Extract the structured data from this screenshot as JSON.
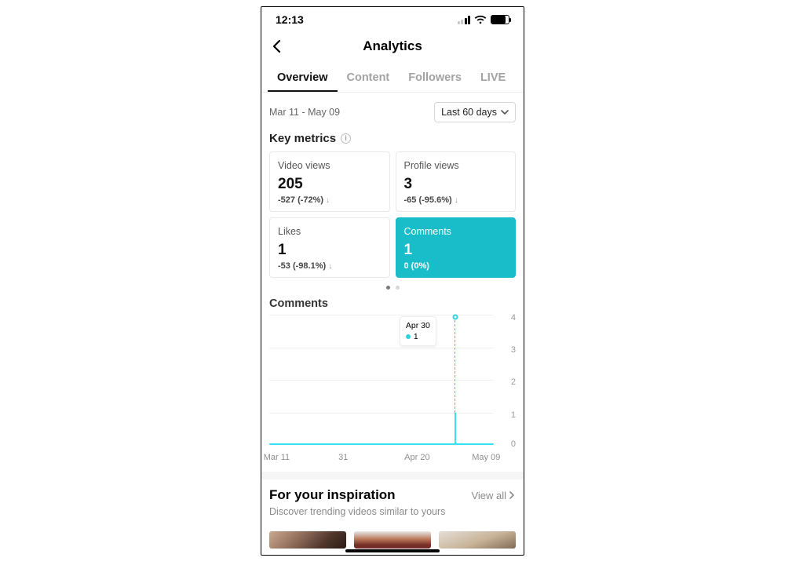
{
  "status": {
    "time": "12:13"
  },
  "nav": {
    "title": "Analytics"
  },
  "tabs": [
    {
      "label": "Overview",
      "active": true
    },
    {
      "label": "Content",
      "active": false
    },
    {
      "label": "Followers",
      "active": false
    },
    {
      "label": "LIVE",
      "active": false
    }
  ],
  "range": {
    "date_span": "Mar 11 - May 09",
    "button_label": "Last 60 days"
  },
  "key_metrics": {
    "heading": "Key metrics",
    "cards": [
      {
        "label": "Video views",
        "value": "205",
        "delta": "-527 (-72%)",
        "selected": false
      },
      {
        "label": "Profile views",
        "value": "3",
        "delta": "-65 (-95.6%)",
        "selected": false
      },
      {
        "label": "Likes",
        "value": "1",
        "delta": "-53 (-98.1%)",
        "selected": false
      },
      {
        "label": "Comments",
        "value": "1",
        "delta": "0 (0%)",
        "selected": true
      }
    ],
    "pager": {
      "total": 2,
      "active": 0
    }
  },
  "chart_section": {
    "heading": "Comments",
    "tooltip_date": "Apr 30",
    "tooltip_value": "1",
    "xlabels": [
      "Mar 11",
      "31",
      "Apr 20",
      "May 09"
    ],
    "ylabels": [
      "0",
      "1",
      "2",
      "3",
      "4"
    ]
  },
  "chart_data": {
    "type": "line",
    "title": "Comments",
    "xlabel": "",
    "ylabel": "",
    "ylim": [
      0,
      4
    ],
    "x_range": [
      "Mar 11",
      "May 09"
    ],
    "x_ticks": [
      "Mar 11",
      "31",
      "Apr 20",
      "May 09"
    ],
    "y_ticks": [
      0,
      1,
      2,
      3,
      4
    ],
    "series": [
      {
        "name": "Comments",
        "points": [
          {
            "x": "Mar 11",
            "y": 0
          },
          {
            "x": "Apr 29",
            "y": 0
          },
          {
            "x": "Apr 30",
            "y": 1
          },
          {
            "x": "May 01",
            "y": 0
          },
          {
            "x": "May 09",
            "y": 0
          }
        ]
      }
    ],
    "highlight": {
      "x": "Apr 30",
      "y": 1
    }
  },
  "inspiration": {
    "heading": "For your inspiration",
    "view_all": "View all",
    "subtitle": "Discover trending videos similar to yours"
  }
}
